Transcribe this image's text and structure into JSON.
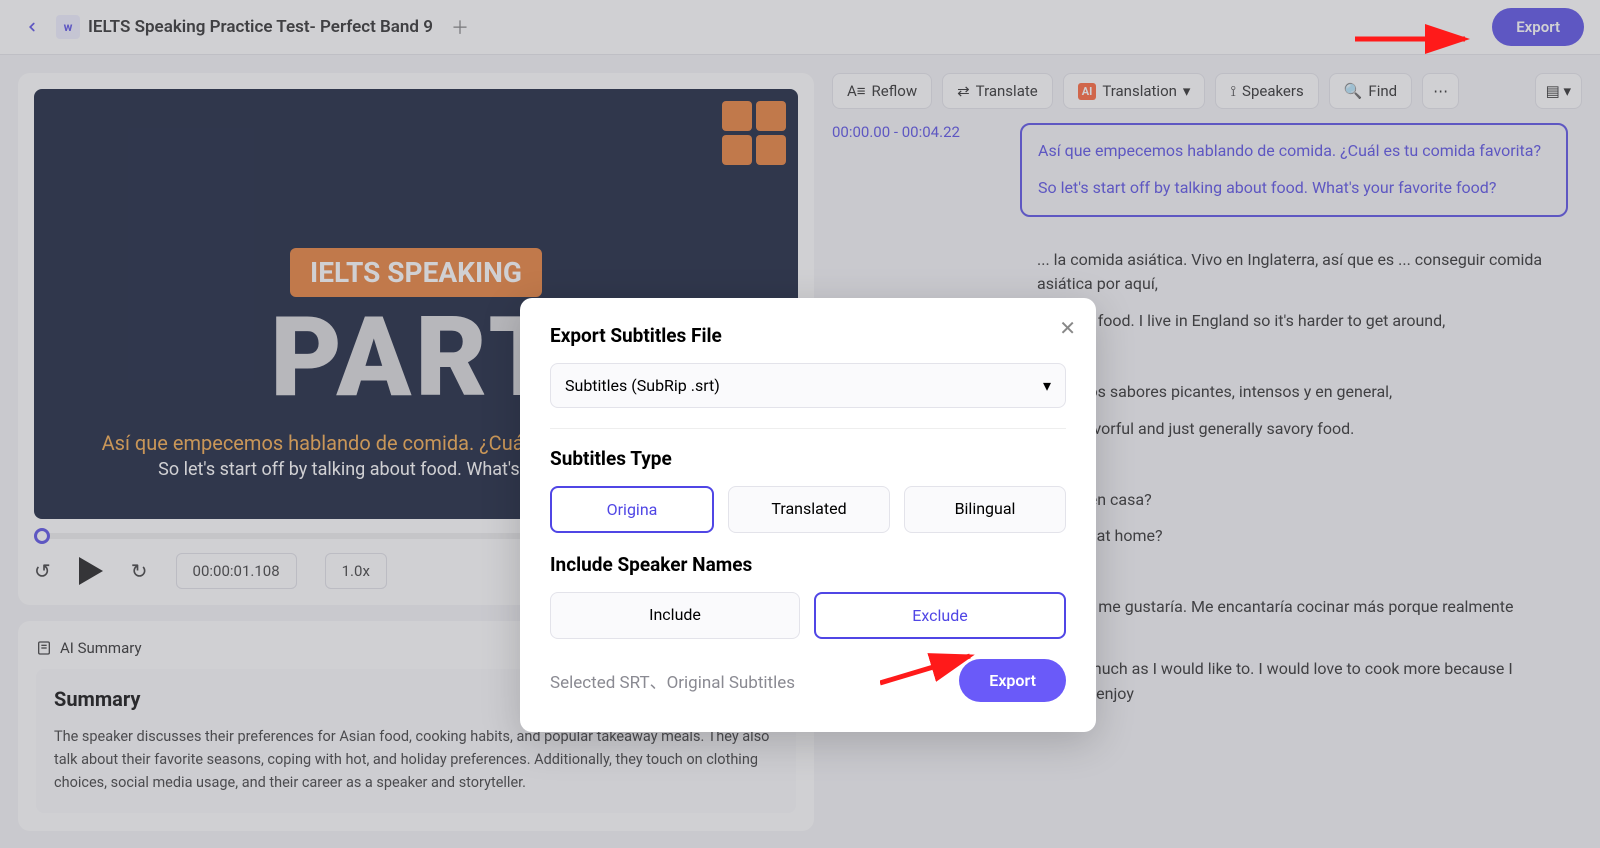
{
  "header": {
    "doc_title": "IELTS Speaking Practice Test- Perfect Band 9",
    "export_label": "Export"
  },
  "video": {
    "badge": "IELTS SPEAKING",
    "part": "PART",
    "sub_es": "Así que empecemos hablando de comida. ¿Cuál es tu comida favorita?",
    "sub_en": "So let's start off by talking about food. What's your favorite food?",
    "timecode": "00:00:01.108",
    "speed": "1.0x"
  },
  "summary": {
    "tab": "AI Summary",
    "title": "Summary",
    "body": "The speaker discusses their preferences for Asian food, cooking habits, and popular takeaway meals. They also talk about their favorite seasons, coping with hot, and holiday preferences. Additionally, they touch on clothing choices, social media usage, and their career as a speaker and storyteller."
  },
  "toolbar": {
    "reflow": "Reflow",
    "translate": "Translate",
    "translation": "Translation",
    "speakers": "Speakers",
    "find": "Find"
  },
  "transcript": [
    {
      "ts": "00:00.00 - 00:04.22",
      "es": "Así que empecemos hablando de comida. ¿Cuál es tu comida favorita?",
      "en": "So let's start off by talking about food. What's your favorite food?",
      "active": true
    },
    {
      "ts": "",
      "es": "... la comida asiática. Vivo en Inglaterra, así que es ... conseguir comida asiática por aquí,",
      "en": "... Asian food. I live in England so it's harder to get around,",
      "active": false
    },
    {
      "ts": "",
      "es": "...stan los sabores picantes, intensos y en general,",
      "en": "...icy, flavorful and just generally savory food.",
      "active": false
    },
    {
      "ts": "",
      "es": "...ucho en casa?",
      "en": "...k a lot at home?",
      "active": false
    },
    {
      "ts": "",
      "es": "... como me gustaría. Me encantaría cocinar más porque realmente disfruto",
      "en": "Not as much as I would like to. I would love to cook more because I actually enjoy",
      "active": false
    }
  ],
  "modal": {
    "title": "Export Subtitles File",
    "format": "Subtitles (SubRip .srt)",
    "type_label": "Subtitles Type",
    "types": [
      "Origina",
      "Translated",
      "Bilingual"
    ],
    "speaker_label": "Include Speaker Names",
    "speaker_opts": [
      "Include",
      "Exclude"
    ],
    "selected_text": "Selected SRT、Original Subtitles",
    "export_label": "Export"
  }
}
